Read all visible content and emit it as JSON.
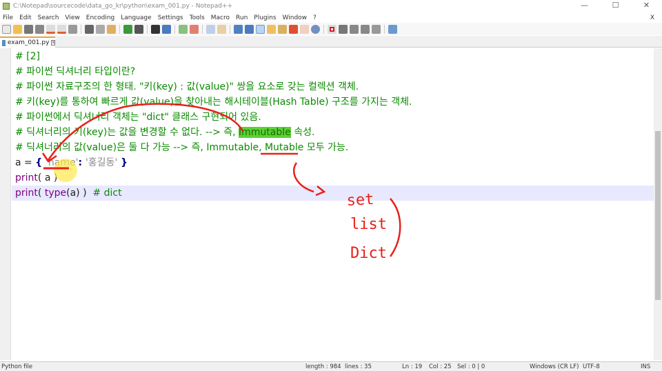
{
  "window": {
    "title": "C:\\Notepad\\sourcecode\\data_go_kr\\python\\exam_001.py - Notepad++",
    "minimize": "—",
    "maximize": "☐",
    "close": "✕"
  },
  "menu": [
    "File",
    "Edit",
    "Search",
    "View",
    "Encoding",
    "Language",
    "Settings",
    "Tools",
    "Macro",
    "Run",
    "Plugins",
    "Window",
    "?"
  ],
  "menu_close": "X",
  "tab": {
    "label": "exam_001.py",
    "close": "x"
  },
  "code": [
    "# [2]",
    "# 파이썬 딕셔너리 타입이란?",
    "# 파이썬 자료구조의 한 형태. \"키(key) : 값(value)\" 쌍을 요소로 갖는 컬렉션 객체.",
    "# 키(key)를 통하여 빠르게 값(value)을 찾아내는 해시테이블(Hash Table) 구조를 가지는 객체.",
    "# 파이썬에서 딕셔너리 객체는 \"dict\" 클래스 구현되어 있음."
  ],
  "line6": {
    "pre": "# 딕셔너리의 키(key)는 값을 변경할 수 없다. --> 즉, ",
    "highlight": "Immutable",
    "post": " 속성."
  },
  "line7": "# 딕셔너리의 값(value)은 둘 다 가능 --> 즉, Immutable, Mutable 모두 가능.",
  "line8": {
    "a": "a = ",
    "ob": "{ ",
    "s1": "'name'",
    "colon": ": ",
    "s2": "'홍길동'",
    "cb": " }"
  },
  "line9": {
    "kw": "print",
    "rest": "( a )"
  },
  "line10": {
    "kw": "print",
    "p1": "( ",
    "kw2": "type",
    "p2": "(a) )",
    "cm": "  # dict"
  },
  "handwriting": [
    "set",
    "list",
    "Dict"
  ],
  "status": {
    "type": "Python file",
    "length": "length : 984",
    "lines": "lines : 35",
    "ln": "Ln : 19",
    "col": "Col : 25",
    "sel": "Sel : 0 | 0",
    "eol": "Windows (CR LF)",
    "enc": "UTF-8",
    "mode": "INS"
  },
  "colors": {
    "comment": "#0a8a00",
    "ink": "#e8201a",
    "highlight": "#5ad235",
    "caret_line": "#e8e8ff"
  }
}
